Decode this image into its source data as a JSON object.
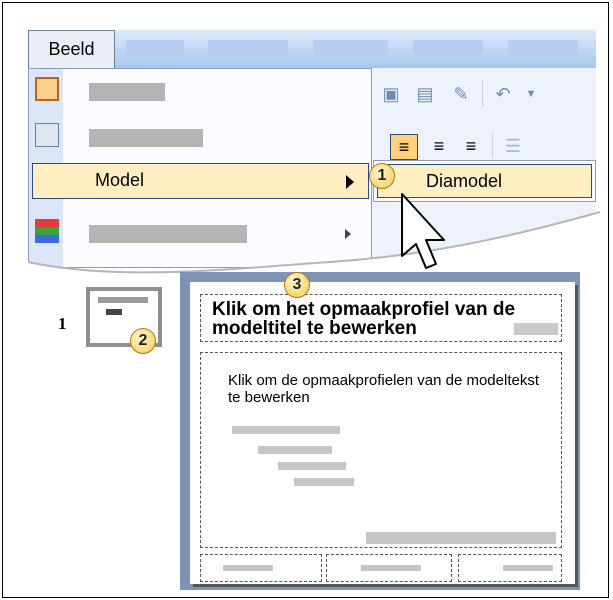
{
  "menu": {
    "beeld_label": "Beeld",
    "model_label": "Model",
    "submenu_label": "Diamodel"
  },
  "callouts": {
    "one": "1",
    "two": "2",
    "three": "3"
  },
  "slide": {
    "number": "1",
    "title": "Klik om het opmaakprofiel van de modeltitel te bewerken",
    "body": "Klik om de opmaakprofielen van de modeltekst te bewerken"
  },
  "icons": [
    "slide-view-icon",
    "notes-view-icon",
    "color-icon",
    "paste-icon",
    "format-painter-icon",
    "undo-icon",
    "align-left-icon",
    "align-center-icon",
    "align-right-icon",
    "bullets-icon",
    "mouse-pointer-icon"
  ],
  "colors": {
    "highlight": "#ffeec2",
    "menubar": "#a9c5ee",
    "callout": "#f7c84e",
    "slide_frame": "#7f93b6"
  }
}
